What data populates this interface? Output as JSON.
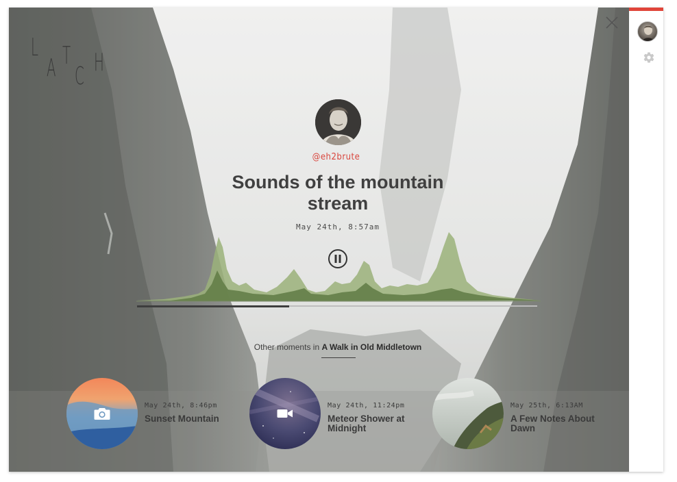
{
  "app": {
    "logo_letters": [
      "L",
      "A",
      "T",
      "C",
      "H"
    ]
  },
  "author": {
    "handle": "@eh2brute"
  },
  "moment": {
    "title": "Sounds of the mountain stream",
    "date": "May 24th, 8:57am",
    "playback_state": "playing",
    "progress": 0.38
  },
  "other": {
    "prefix": "Other moments in",
    "collection": "A Walk in Old Middletown"
  },
  "moments": [
    {
      "date": "May 24th, 8:46pm",
      "title": "Sunset Mountain",
      "icon": "camera-icon"
    },
    {
      "date": "May 24th, 11:24pm",
      "title": "Meteor Shower at Midnight",
      "icon": "video-icon"
    },
    {
      "date": "May 25th, 6:13AM",
      "title": "A Few Notes About Dawn",
      "icon": "none"
    }
  ],
  "colors": {
    "accent": "#e0453a",
    "wave_light": "#8fa86a",
    "wave_dark": "#5e7a43"
  }
}
